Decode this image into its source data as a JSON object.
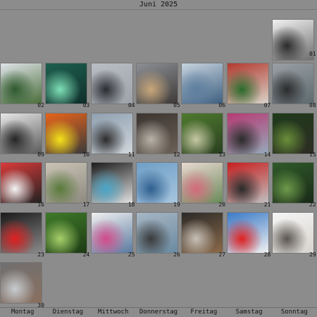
{
  "calendar": {
    "title": "Juni 2025",
    "weekdays": [
      "Montag",
      "Dienstag",
      "Mittwoch",
      "Donnerstag",
      "Freitag",
      "Samstag",
      "Sonntag"
    ],
    "days": [
      {
        "day": "01",
        "icon": "street-sculpture-photo",
        "colors": [
          "#f0f0f0",
          "#2a2a2a",
          "#6f6f6f"
        ]
      },
      {
        "day": "02",
        "icon": "tree-photo",
        "colors": [
          "#dfe3e8",
          "#2f5a2f",
          "#4a6e3a"
        ]
      },
      {
        "day": "03",
        "icon": "green-glass-photo",
        "colors": [
          "#1e5f4e",
          "#7fe0b8",
          "#0f2f2a"
        ]
      },
      {
        "day": "04",
        "icon": "city-skyline-photo",
        "colors": [
          "#b9bdc4",
          "#2a2c30",
          "#9ea3aa"
        ]
      },
      {
        "day": "05",
        "icon": "building-construction-photo",
        "colors": [
          "#8b8e93",
          "#c9a77a",
          "#3e3a38"
        ]
      },
      {
        "day": "06",
        "icon": "lake-view-photo",
        "colors": [
          "#c7d3df",
          "#5e7f9f",
          "#3d5f7f"
        ]
      },
      {
        "day": "07",
        "icon": "bottles-photo",
        "colors": [
          "#b33a2f",
          "#2b6b2b",
          "#d8d2c8"
        ]
      },
      {
        "day": "08",
        "icon": "birds-on-water-photo",
        "colors": [
          "#9aa0a5",
          "#2b2b2b",
          "#5d6a70"
        ]
      },
      {
        "day": "09",
        "icon": "industrial-tower-photo",
        "colors": [
          "#e6e6e6",
          "#252525",
          "#5b5b5b"
        ]
      },
      {
        "day": "10",
        "icon": "yellow-toy-photo",
        "colors": [
          "#e8641a",
          "#f5e21a",
          "#3b3b3b"
        ]
      },
      {
        "day": "11",
        "icon": "building-facade-photo",
        "colors": [
          "#8fa0b0",
          "#2c2c2c",
          "#d0d6dc"
        ]
      },
      {
        "day": "12",
        "icon": "glass-bowl-photo",
        "colors": [
          "#3b3430",
          "#b8b2a8",
          "#6c6157"
        ]
      },
      {
        "day": "13",
        "icon": "trees-photo",
        "colors": [
          "#4e7a2e",
          "#c7c9a4",
          "#2a3f20"
        ]
      },
      {
        "day": "14",
        "icon": "flowers-street-photo",
        "colors": [
          "#b73a74",
          "#2b2b2b",
          "#95a8b8"
        ]
      },
      {
        "day": "15",
        "icon": "forest-photo",
        "colors": [
          "#1f3a1a",
          "#6a8f3a",
          "#2d2d24"
        ]
      },
      {
        "day": "16",
        "icon": "no-pedestrian-sign-photo",
        "colors": [
          "#d93a3a",
          "#f4f4f4",
          "#222222"
        ]
      },
      {
        "day": "17",
        "icon": "pavement-weeds-photo",
        "colors": [
          "#c9c3b5",
          "#5a7a3a",
          "#8e8a80"
        ]
      },
      {
        "day": "18",
        "icon": "minolta-lens-photo",
        "colors": [
          "#1c1c1c",
          "#4aa6c8",
          "#e0e0e0"
        ]
      },
      {
        "day": "19",
        "icon": "blue-glass-wall-photo",
        "colors": [
          "#6f9fc6",
          "#2f5f8f",
          "#a8c6df"
        ]
      },
      {
        "day": "20",
        "icon": "pink-flower-vase-photo",
        "colors": [
          "#e8d8d0",
          "#d46a7a",
          "#6a8a5a"
        ]
      },
      {
        "day": "21",
        "icon": "red-car-photo",
        "colors": [
          "#c81e1e",
          "#2a2a2a",
          "#bfbfbf"
        ]
      },
      {
        "day": "22",
        "icon": "garden-photo",
        "colors": [
          "#2f5a2a",
          "#6e9a4a",
          "#1a2a18"
        ]
      },
      {
        "day": "23",
        "icon": "traffic-light-photo",
        "colors": [
          "#1a1a1a",
          "#e02020",
          "#8a8a8a"
        ]
      },
      {
        "day": "24",
        "icon": "fern-photo",
        "colors": [
          "#3f7a2a",
          "#a6d06a",
          "#1d3a14"
        ]
      },
      {
        "day": "25",
        "icon": "flower-mirror-photo",
        "colors": [
          "#f0f0f0",
          "#d24a8a",
          "#5a7aa0"
        ]
      },
      {
        "day": "26",
        "icon": "lake-bench-photo",
        "colors": [
          "#a6b6c4",
          "#3a3a3a",
          "#6a8aa0"
        ]
      },
      {
        "day": "27",
        "icon": "coffee-cup-photo",
        "colors": [
          "#2c2a28",
          "#c8c0b6",
          "#8a6a4a"
        ]
      },
      {
        "day": "28",
        "icon": "swiss-flag-boat-photo",
        "colors": [
          "#3a7ac8",
          "#e02020",
          "#f0f0f0"
        ]
      },
      {
        "day": "29",
        "icon": "bright-window-photo",
        "colors": [
          "#f5f5f5",
          "#5a5550",
          "#d8d4ce"
        ]
      },
      {
        "day": "30",
        "icon": "glass-corridor-photo",
        "colors": [
          "#6f6f70",
          "#c8ccd0",
          "#8a7060"
        ]
      }
    ]
  }
}
